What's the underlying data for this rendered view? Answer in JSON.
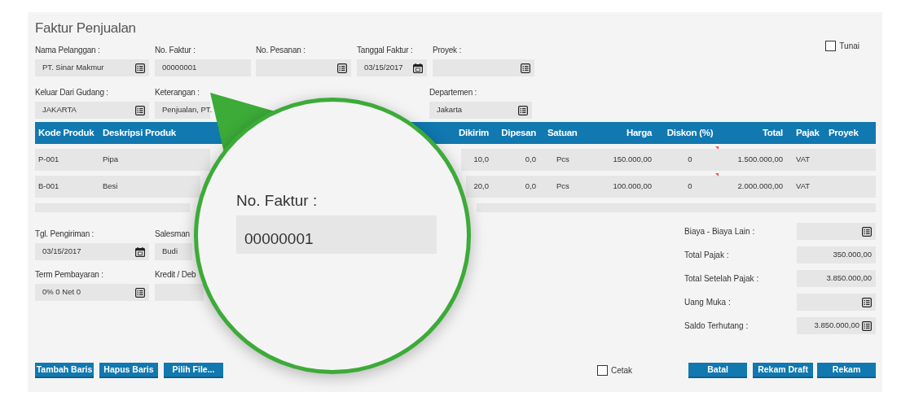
{
  "title": "Faktur Penjualan",
  "header_rows": [
    [
      {
        "label": "Nama Pelanggan :",
        "value": "PT. Sinar Makmur",
        "kind": "lookup"
      },
      {
        "label": "No. Faktur :",
        "value": "00000001",
        "kind": "plain"
      },
      {
        "label": "No. Pesanan :",
        "kind": "lookup"
      },
      {
        "label": "Tanggal Faktur :",
        "value": "03/15/2017",
        "kind": "date"
      },
      {
        "label": "Proyek :",
        "kind": "lookup"
      }
    ],
    [
      {
        "label": "Keluar Dari Gudang :",
        "value": "JAKARTA",
        "kind": "lookup"
      },
      {
        "label": "Keterangan :",
        "value": "Penjualan, PT.",
        "kind": "plain"
      },
      {
        "label": "Departemen :",
        "value": "Jakarta",
        "kind": "lookup"
      }
    ]
  ],
  "tunai": {
    "label": "Tunai",
    "checked": false
  },
  "table": {
    "columns": [
      "Kode Produk",
      "Deskripsi Produk",
      "Dikirim",
      "Dipesan",
      "Satuan",
      "Harga",
      "Diskon (%)",
      "Total",
      "Pajak",
      "Proyek"
    ],
    "rows": [
      {
        "cells": [
          "P-001",
          "Pipa",
          "10,0",
          "0,0",
          "Pcs",
          "150.000,00",
          "0",
          "1.500.000,00",
          "VAT"
        ],
        "note": true
      },
      {
        "cells": [
          "B-001",
          "Besi",
          "20,0",
          "0,0",
          "Pcs",
          "100.000,00",
          "0",
          "2.000.000,00",
          "VAT"
        ],
        "note": true
      }
    ]
  },
  "footer_rows": [
    [
      {
        "label": "Tgl. Pengiriman :",
        "value": "03/15/2017",
        "kind": "date"
      },
      {
        "label": "Salesman",
        "value": "Budi",
        "kind": "plain"
      }
    ],
    [
      {
        "label": "Term Pembayaran :",
        "value": "0% 0 Net 0",
        "kind": "lookup"
      },
      {
        "label": "Kredit / Deb",
        "kind": "plain"
      }
    ]
  ],
  "summary": [
    {
      "label": "Biaya - Biaya Lain :",
      "kind": "lookup"
    },
    {
      "label": "Total Pajak :",
      "value": "350.000,00",
      "kind": "plain"
    },
    {
      "label": "Total Setelah Pajak :",
      "value": "3.850.000,00",
      "kind": "plain"
    },
    {
      "label": "Uang Muka :",
      "kind": "lookup"
    },
    {
      "label": "Saldo Terhutang :",
      "value": "3.850.000,00",
      "kind": "lookup"
    }
  ],
  "left_buttons": [
    "Tambah Baris",
    "Hapus Baris",
    "Pilih File..."
  ],
  "cetak": {
    "label": "Cetak",
    "checked": false
  },
  "right_buttons": [
    "Batal",
    "Rekam Draft",
    "Rekam"
  ],
  "magnifier": {
    "label": "No. Faktur :",
    "value": "00000001"
  }
}
